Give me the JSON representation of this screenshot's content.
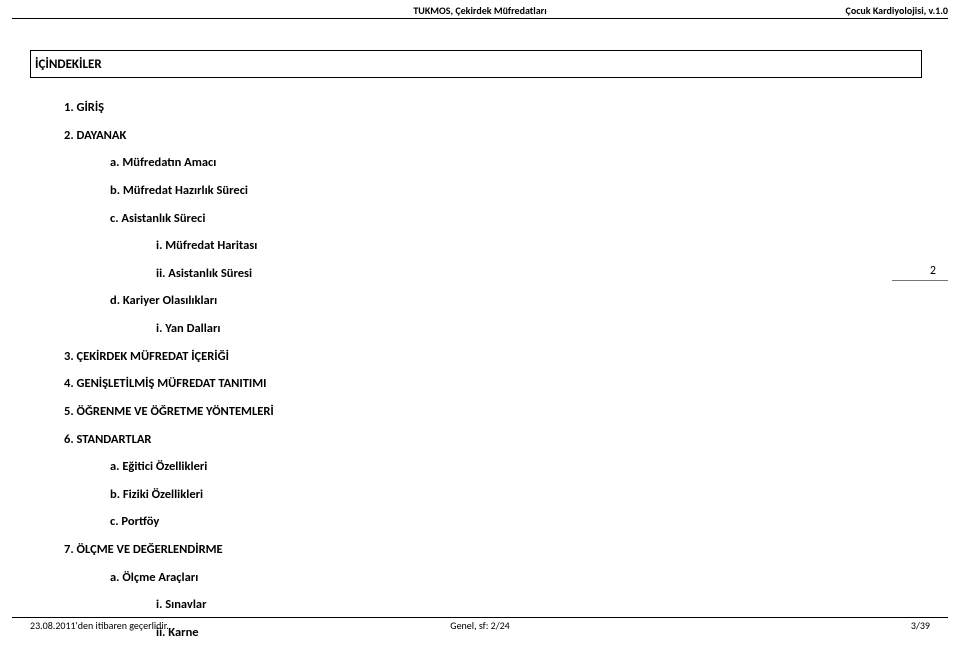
{
  "header": {
    "center": "TUKMOS, Çekirdek Müfredatları",
    "right": "Çocuk Kardiyolojisi, v.1.0"
  },
  "title_box": "İÇİNDEKİLER",
  "toc": {
    "i1": "1.  GİRİŞ",
    "i2": "2.  DAYANAK",
    "i2a": "a.  Müfredatın Amacı",
    "i2b": "b.  Müfredat Hazırlık Süreci",
    "i2c": "c.  Asistanlık Süreci",
    "i2ci": "i.  Müfredat Haritası",
    "i2cii": "ii.  Asistanlık Süresi",
    "i2d": "d.  Kariyer Olasılıkları",
    "i2di": "i.  Yan Dalları",
    "i3": "3.  ÇEKİRDEK MÜFREDAT İÇERİĞİ",
    "i4": "4.  GENİŞLETİLMİŞ MÜFREDAT TANITIMI",
    "i5": "5.  ÖĞRENME VE ÖĞRETME YÖNTEMLERİ",
    "i6": "6.  STANDARTLAR",
    "i6a": "a.  Eğitici Özellikleri",
    "i6b": "b.  Fiziki Özellikleri",
    "i6c": "c.  Portföy",
    "i7": "7.  ÖLÇME VE DEĞERLENDİRME",
    "i7a": "a.  Ölçme Araçları",
    "i7ai": "i.  Sınavlar",
    "i7aii": "ii.  Karne"
  },
  "side_page_num": "2",
  "footer": {
    "left": "23.08.2011'den itibaren geçerlidir.",
    "center": "Genel, sf: 2/24",
    "right": "3/39"
  }
}
